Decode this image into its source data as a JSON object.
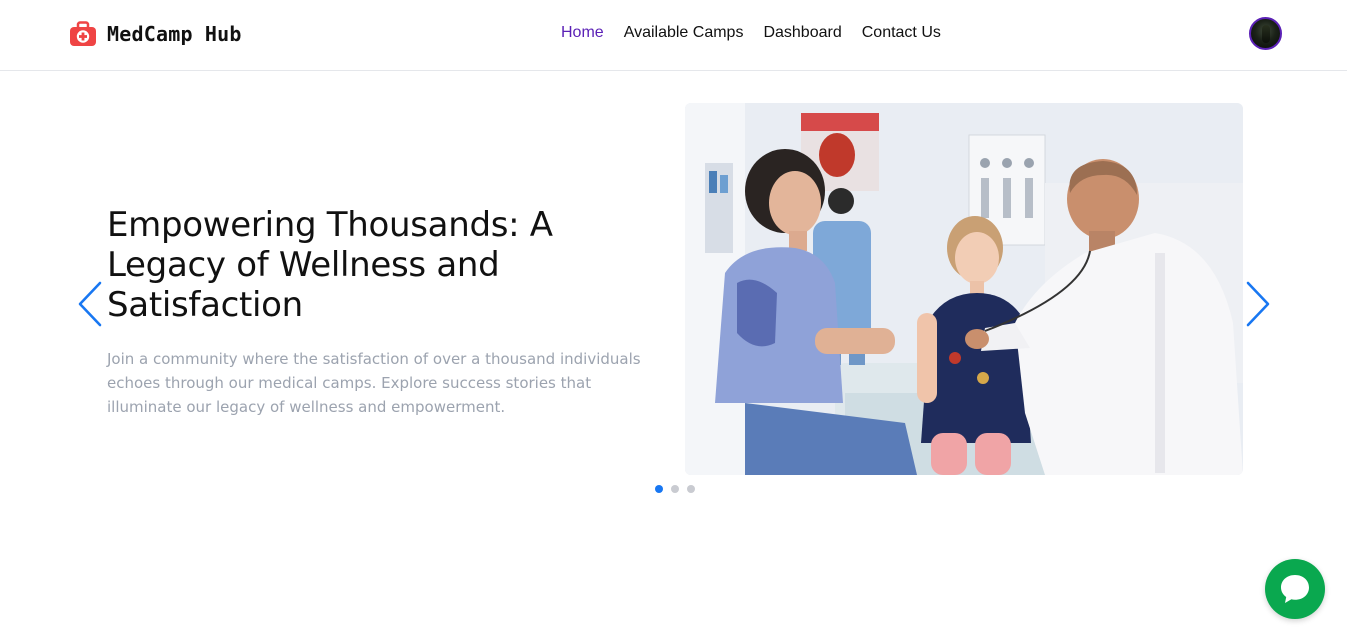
{
  "brand": {
    "name": "MedCamp Hub",
    "icon": "first-aid-kit-icon",
    "color": "#ef4444"
  },
  "nav": {
    "items": [
      {
        "label": "Home",
        "active": true
      },
      {
        "label": "Available Camps",
        "active": false
      },
      {
        "label": "Dashboard",
        "active": false
      },
      {
        "label": "Contact Us",
        "active": false
      }
    ],
    "active_color": "#5b21b6"
  },
  "user": {
    "avatar": "user-avatar"
  },
  "carousel": {
    "title": "Empowering Thousands: A Legacy of Wellness and Satisfaction",
    "description": "Join a community where the satisfaction of over a thousand individuals echoes through our medical camps. Explore success stories that illuminate our legacy of wellness and empowerment.",
    "prev_icon": "chevron-left-icon",
    "next_icon": "chevron-right-icon",
    "arrow_color": "#1877f2",
    "image": "doctor-examining-child-photo",
    "slide_count": 3,
    "active_slide": 1
  },
  "chat": {
    "icon": "chat-bubble-icon",
    "color": "#0aa84f"
  }
}
